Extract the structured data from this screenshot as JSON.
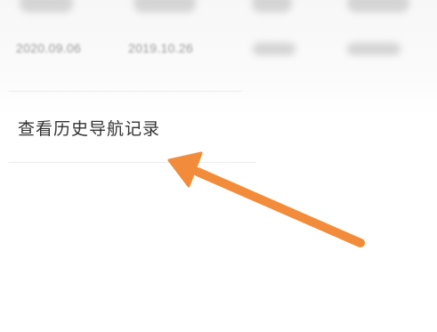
{
  "history_list": {
    "dates": [
      "2020.09.06",
      "2019.10.26"
    ]
  },
  "actions": {
    "view_history_label": "查看历史导航记录"
  },
  "annotation": {
    "arrow_color": "#F28C3A"
  }
}
